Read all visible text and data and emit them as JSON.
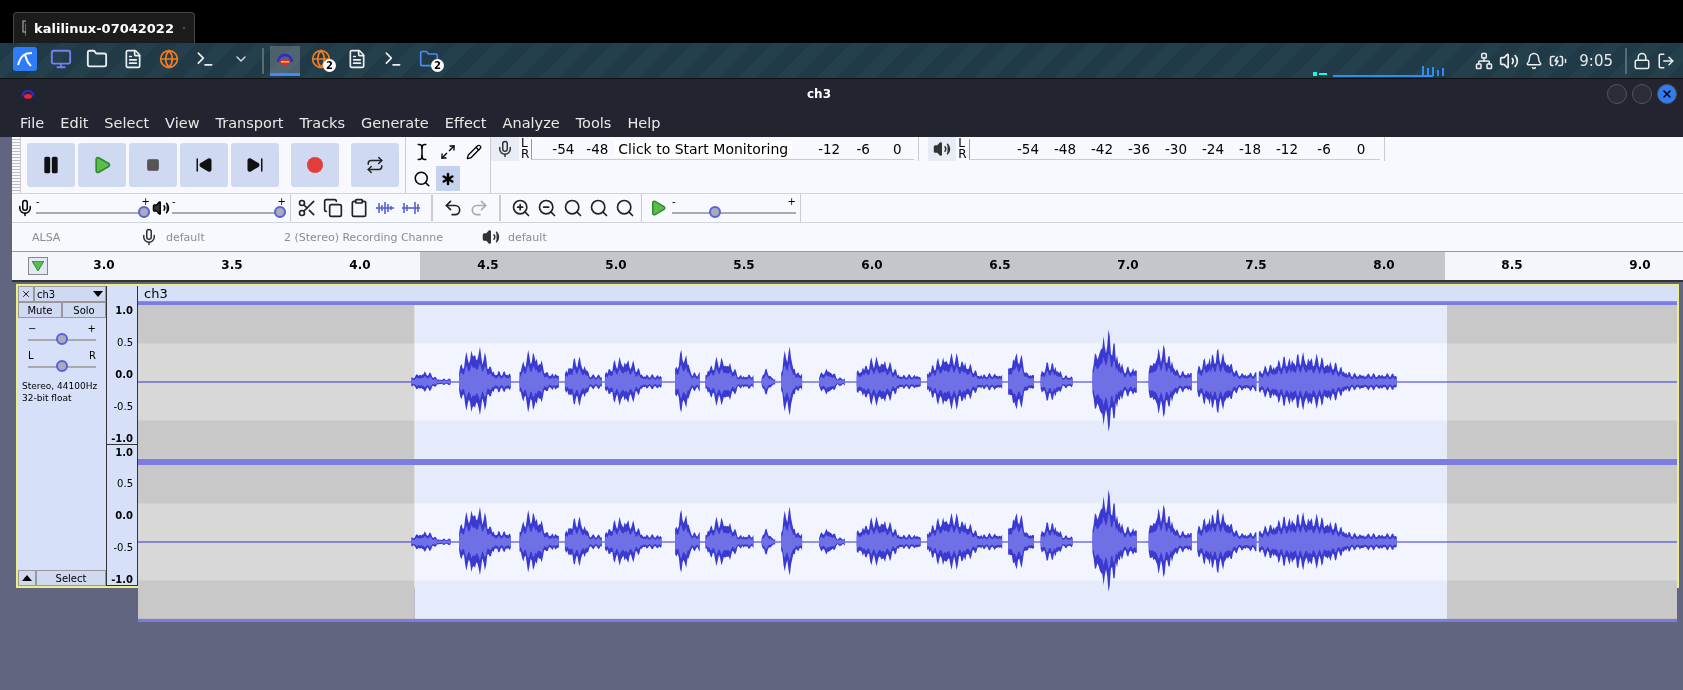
{
  "host_tab": {
    "title": "kalilinux-07042022"
  },
  "taskbar": {
    "launchers": [
      {
        "kind": "kali"
      },
      {
        "kind": "workspace"
      },
      {
        "kind": "files"
      },
      {
        "kind": "editor"
      },
      {
        "kind": "browser"
      },
      {
        "kind": "terminal"
      },
      {
        "kind": "caret"
      }
    ],
    "apps": [
      {
        "kind": "audacity",
        "selected": true
      },
      {
        "kind": "browser",
        "selected": false,
        "badge": "2"
      },
      {
        "kind": "editor",
        "selected": false
      },
      {
        "kind": "terminal",
        "selected": false
      },
      {
        "kind": "folder",
        "selected": false,
        "badge": "2"
      }
    ],
    "tray": [
      {
        "kind": "network"
      },
      {
        "kind": "volume"
      },
      {
        "kind": "bell"
      },
      {
        "kind": "battery"
      },
      {
        "kind": "clock",
        "text": "9:05"
      },
      {
        "kind": "separator"
      },
      {
        "kind": "lock"
      },
      {
        "kind": "logout"
      }
    ]
  },
  "window": {
    "title": "ch3"
  },
  "menu": [
    "File",
    "Edit",
    "Select",
    "View",
    "Transport",
    "Tracks",
    "Generate",
    "Effect",
    "Analyze",
    "Tools",
    "Help"
  ],
  "transport": [
    {
      "kind": "pause"
    },
    {
      "kind": "play"
    },
    {
      "kind": "stop"
    },
    {
      "kind": "skip-start"
    },
    {
      "kind": "skip-end"
    },
    {
      "kind": "record"
    },
    {
      "kind": "loop"
    }
  ],
  "tools": [
    {
      "kind": "ibeam",
      "selected": false
    },
    {
      "kind": "envelope",
      "selected": false
    },
    {
      "kind": "pencil",
      "selected": false
    },
    {
      "kind": "zoom",
      "selected": false
    },
    {
      "kind": "multi",
      "selected": true
    }
  ],
  "record_meter": {
    "channels": [
      "L",
      "R"
    ],
    "ticks_before": [
      "-54",
      "-48"
    ],
    "hint": "Click to Start Monitoring",
    "ticks_after": [
      "-12",
      "-6",
      "0"
    ]
  },
  "play_meter": {
    "channels": [
      "L",
      "R"
    ],
    "ticks": [
      "-54",
      "-48",
      "-42",
      "-36",
      "-30",
      "-24",
      "-18",
      "-12",
      "-6",
      "0"
    ]
  },
  "mixer": [
    {
      "kind": "mic",
      "minus": "-",
      "plus": "+",
      "level": 1.0
    },
    {
      "kind": "speaker",
      "minus": "-",
      "plus": "+",
      "level": 1.0
    }
  ],
  "edit_tools": [
    {
      "kind": "cut"
    },
    {
      "kind": "copy"
    },
    {
      "kind": "paste"
    },
    {
      "kind": "trim"
    },
    {
      "kind": "silence"
    },
    {
      "kind": "gap"
    },
    {
      "kind": "undo",
      "disabled": false
    },
    {
      "kind": "redo",
      "disabled": true
    },
    {
      "kind": "gap"
    },
    {
      "kind": "zoom-in"
    },
    {
      "kind": "zoom-out"
    },
    {
      "kind": "fit-selection"
    },
    {
      "kind": "fit-project"
    },
    {
      "kind": "zoom-toggle"
    }
  ],
  "play_at_speed": {
    "minus": "-",
    "plus": "+",
    "level": 0.33
  },
  "devices": [
    {
      "kind": "text",
      "text": "ALSA"
    },
    {
      "kind": "mic"
    },
    {
      "kind": "text",
      "text": "default"
    },
    {
      "kind": "text",
      "text": "2 (Stereo) Recording Channe"
    },
    {
      "kind": "speaker"
    },
    {
      "kind": "text",
      "text": "default"
    }
  ],
  "ruler": {
    "ticks": [
      "3.0",
      "3.5",
      "4.0",
      "4.5",
      "5.0",
      "5.5",
      "6.0",
      "6.5",
      "7.0",
      "7.5",
      "8.0",
      "8.5",
      "9.0"
    ]
  },
  "track": {
    "name": "ch3",
    "mute": "Mute",
    "solo": "Solo",
    "gain": {
      "minus": "−",
      "plus": "+",
      "level": 0.5
    },
    "pan": {
      "left": "L",
      "right": "R",
      "level": 0.5
    },
    "info": [
      "Stereo, 44100Hz",
      "32-bit float"
    ],
    "select": "Select",
    "title": "ch3",
    "channels": [
      {
        "scale": [
          "1.0",
          "0.5",
          "0.0",
          "-0.5",
          "-1.0"
        ]
      },
      {
        "scale": [
          "1.0",
          "0.5",
          "0.0",
          "-0.5",
          "-1.0"
        ]
      }
    ]
  }
}
